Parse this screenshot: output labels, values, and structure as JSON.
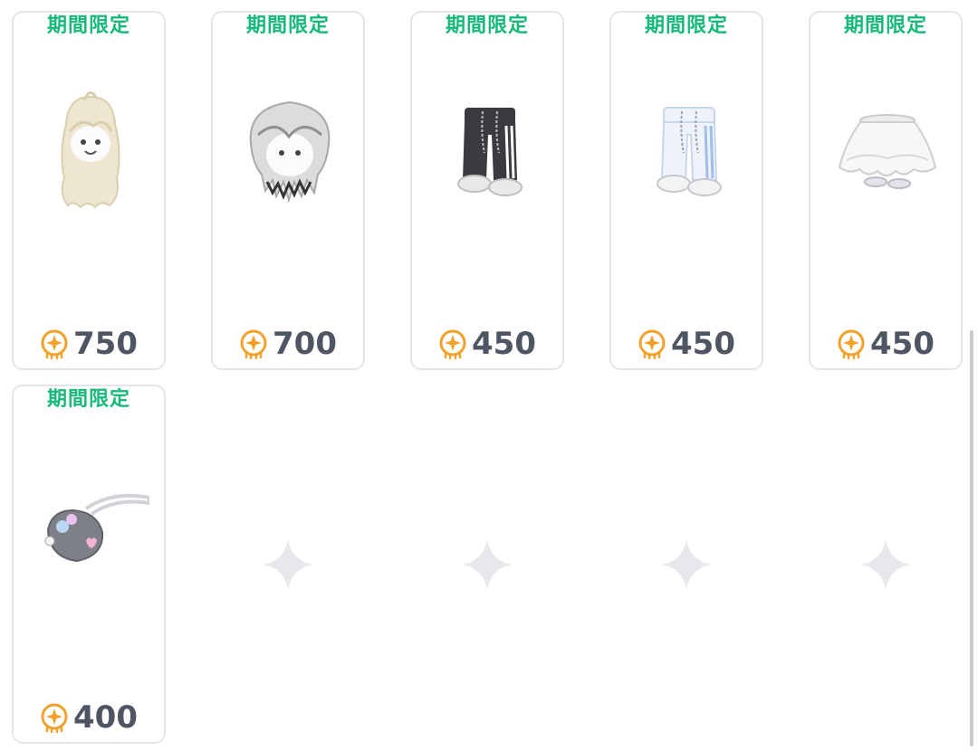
{
  "shop_grid": {
    "items": [
      {
        "badge": "期間限定",
        "price": "750",
        "art_icon": "long-wavy-hair-icon",
        "art_color": "#efe6cf"
      },
      {
        "badge": "期間限定",
        "price": "700",
        "art_icon": "shaggy-hair-icon",
        "art_color": "#dcdcdc"
      },
      {
        "badge": "期間限定",
        "price": "450",
        "art_icon": "black-striped-pants-icon",
        "art_color": "#3a3b40"
      },
      {
        "badge": "期間限定",
        "price": "450",
        "art_icon": "white-striped-pants-icon",
        "art_color": "#eef3fb"
      },
      {
        "badge": "期間限定",
        "price": "450",
        "art_icon": "white-frilly-skirt-icon",
        "art_color": "#f4f4f4"
      },
      {
        "badge": "期間限定",
        "price": "400",
        "art_icon": "gray-pouch-bag-icon",
        "art_color": "#7d8087"
      }
    ],
    "empty_slots": [
      {
        "icon": "sparkle-icon"
      },
      {
        "icon": "sparkle-icon"
      },
      {
        "icon": "sparkle-icon"
      },
      {
        "icon": "sparkle-icon"
      }
    ]
  },
  "colors": {
    "badge": "#17b978",
    "price_text": "#4f5663",
    "coin": "#f2a22b",
    "card_border": "#e3e5e8",
    "empty_sparkle": "#e6e8eb"
  }
}
